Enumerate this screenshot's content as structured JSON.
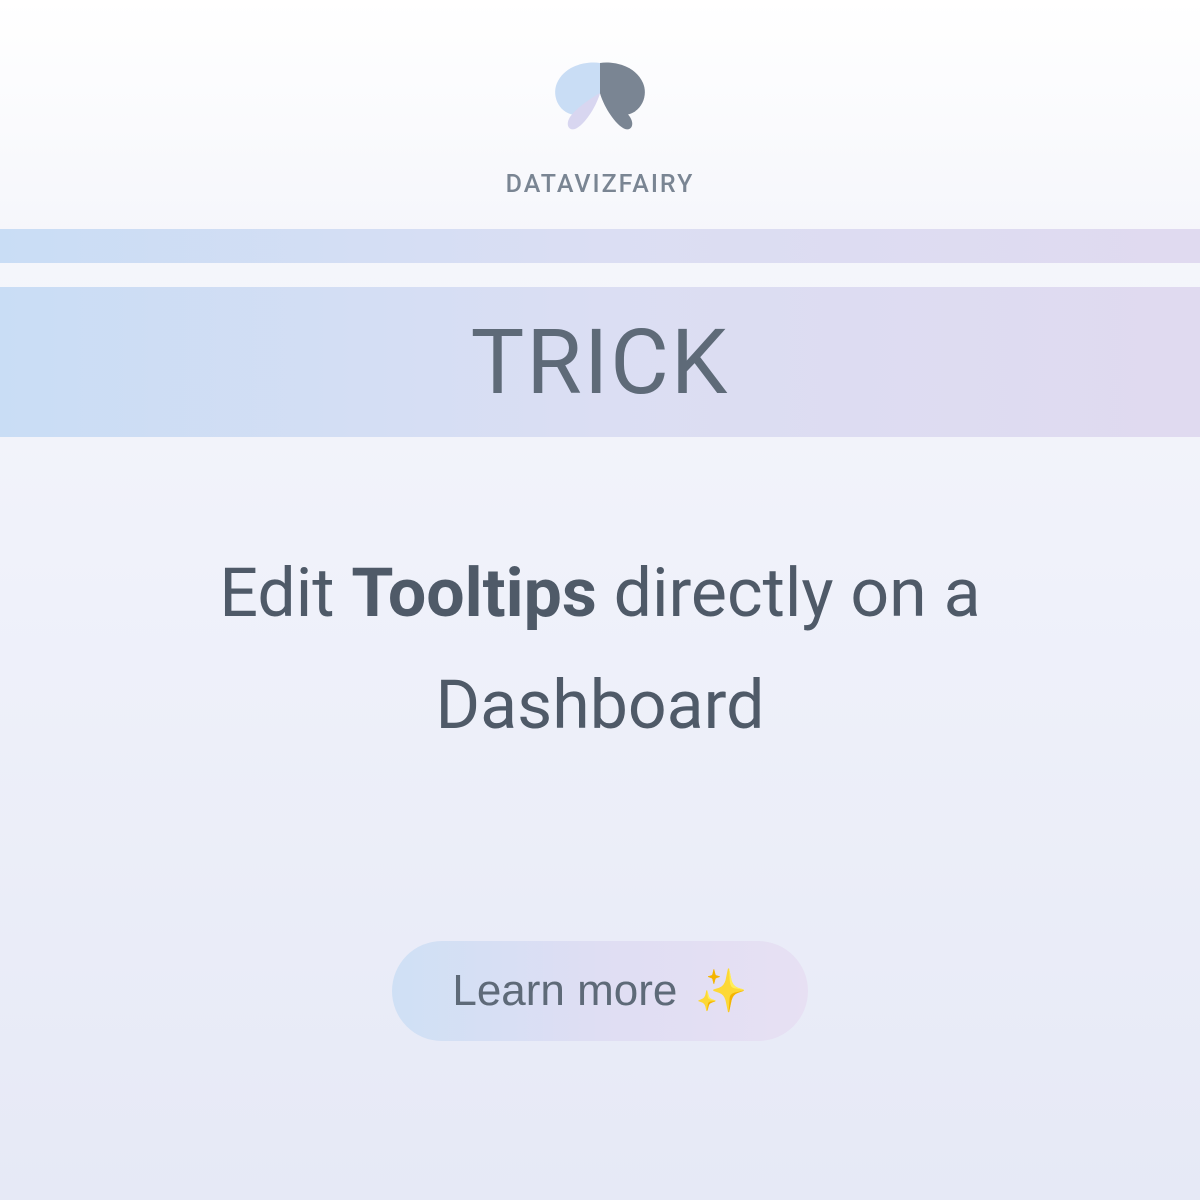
{
  "header": {
    "brand_name": "DATAVIZFAIRY"
  },
  "banner": {
    "label": "TRICK"
  },
  "main": {
    "text_before": "Edit ",
    "text_bold": "Tooltips",
    "text_after": " directly on a Dashboard"
  },
  "cta": {
    "label": "Learn more",
    "sparkle": "✨"
  }
}
